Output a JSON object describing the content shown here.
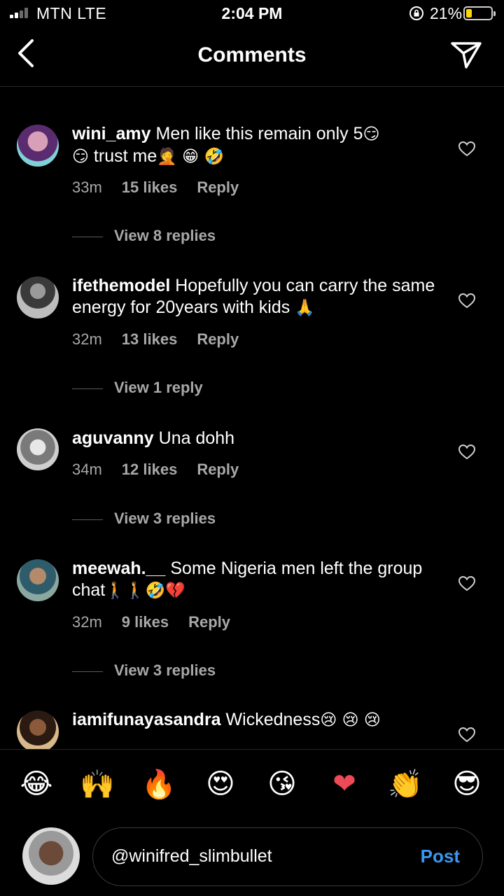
{
  "status_bar": {
    "carrier": "MTN  LTE",
    "time": "2:04 PM",
    "battery": "21%",
    "battery_level": 0.21
  },
  "header": {
    "title": "Comments"
  },
  "comments": [
    {
      "username": "wini_amy",
      "text_1": "Men like this remain only 5",
      "emoji_1": "😏",
      "emoji_2": "😏",
      "text_2": " trust me",
      "emoji_3": "🤦",
      "emoji_4": " 😁 🤣",
      "time": "33m",
      "likes": "15 likes",
      "reply": "Reply",
      "view_replies": "View 8 replies"
    },
    {
      "username": "ifethemodel",
      "text_1": "Hopefully you can carry the same energy for 20years with kids ",
      "emoji_1": "🙏",
      "time": "32m",
      "likes": "13 likes",
      "reply": "Reply",
      "view_replies": "View 1 reply"
    },
    {
      "username": "aguvanny",
      "text_1": "Una dohh",
      "time": "34m",
      "likes": "12 likes",
      "reply": "Reply",
      "view_replies": "View 3 replies"
    },
    {
      "username": "meewah.__",
      "text_1": "Some Nigeria men left the group chat",
      "emoji_1": "🚶🚶🤣💔",
      "time": "32m",
      "likes": "9 likes",
      "reply": "Reply",
      "view_replies": "View 3 replies"
    },
    {
      "username": "iamifunayasandra",
      "text_1": "Wickedness",
      "emoji_1": "😢 😢 😢"
    }
  ],
  "emoji_bar": [
    "😂",
    "🙌",
    "🔥",
    "😍",
    "😘",
    "❤",
    "👏",
    "😎"
  ],
  "composer": {
    "value": "@winifred_slimbullet",
    "post_label": "Post"
  }
}
